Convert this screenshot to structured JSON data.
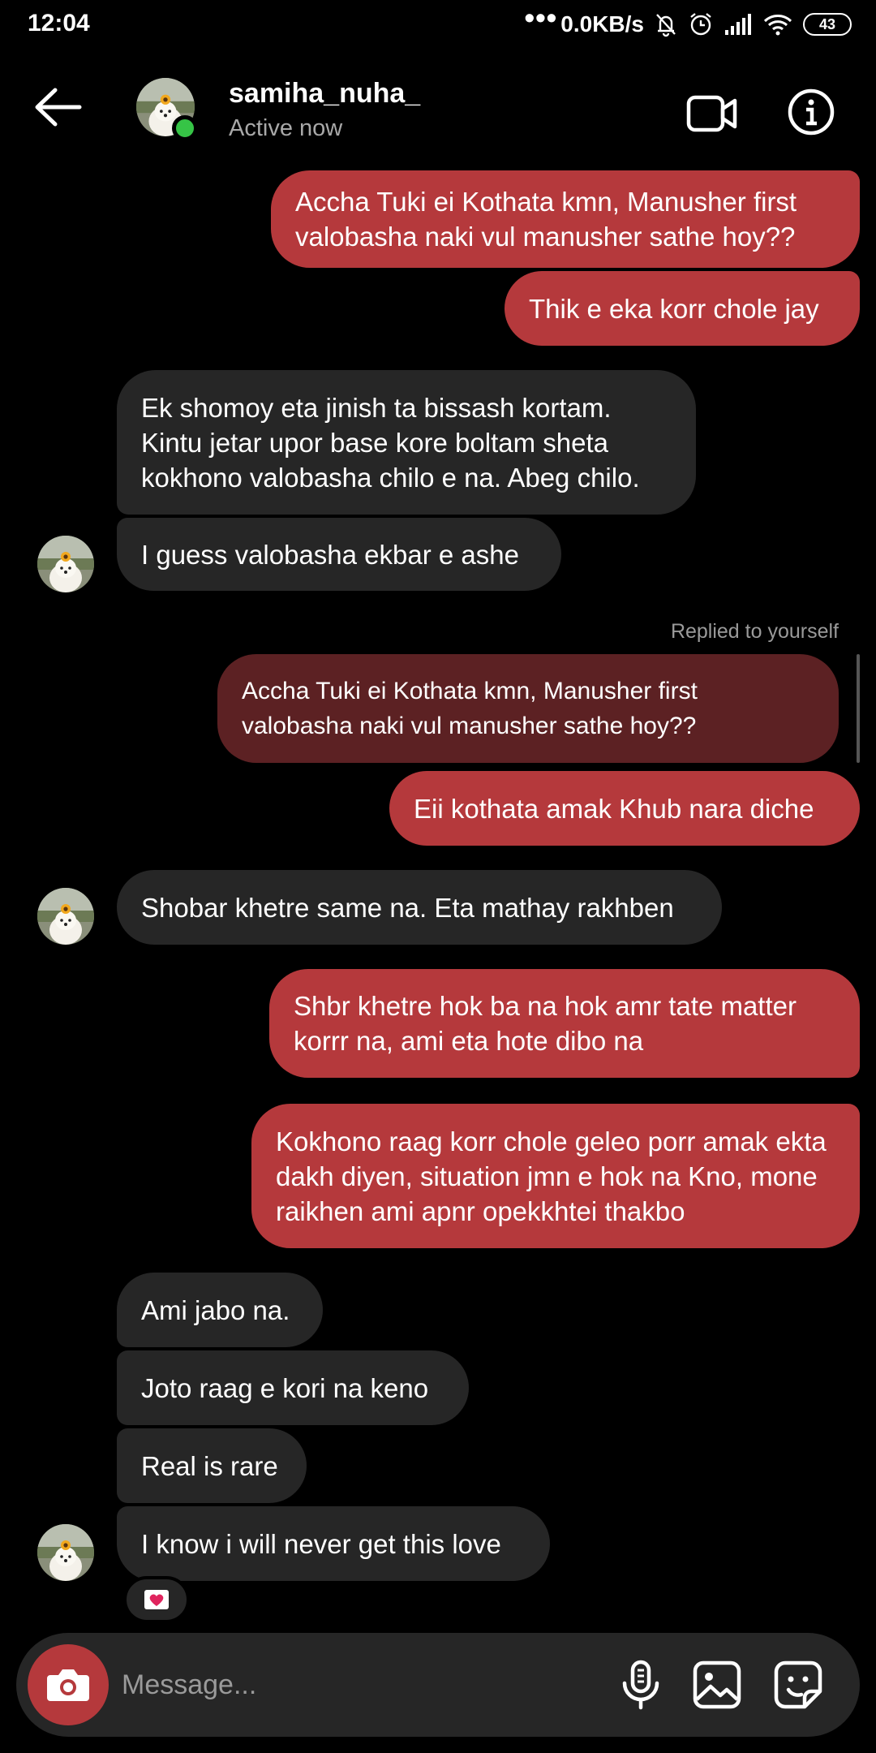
{
  "status_bar": {
    "time": "12:04",
    "dots": "•••",
    "network_speed": "0.0KB/s",
    "battery": "43"
  },
  "header": {
    "username": "samiha_nuha_",
    "status": "Active now",
    "icons": [
      "back-arrow-icon",
      "video-call-icon",
      "info-icon"
    ]
  },
  "messages": [
    {
      "dir": "out",
      "text": "Accha Tuki ei Kothata kmn, Manusher first valobasha naki vul manusher sathe hoy??"
    },
    {
      "dir": "out",
      "text": "Thik e eka korr chole jay"
    },
    {
      "dir": "in",
      "text": "Ek shomoy eta jinish ta bissash kortam. Kintu jetar upor base kore boltam sheta kokhono valobasha chilo e na. Abeg chilo."
    },
    {
      "dir": "in",
      "text": "I guess valobasha ekbar e ashe"
    },
    {
      "dir": "reply_label",
      "text": "Replied to yourself"
    },
    {
      "dir": "quoted",
      "text": "Accha Tuki ei Kothata kmn, Manusher first valobasha naki vul manusher sathe hoy??"
    },
    {
      "dir": "out",
      "text": "Eii kothata amak Khub nara diche"
    },
    {
      "dir": "in",
      "text": "Shobar khetre same na. Eta mathay rakhben"
    },
    {
      "dir": "out",
      "text": "Shbr khetre hok ba na hok amr tate matter korrr na, ami eta hote dibo na"
    },
    {
      "dir": "out",
      "text": "Kokhono raag korr chole geleo porr amak ekta dakh diyen, situation jmn e hok na Kno, mone raikhen ami apnr opekkhtei thakbo"
    },
    {
      "dir": "in",
      "text": "Ami jabo na."
    },
    {
      "dir": "in",
      "text": "Joto raag e kori na keno"
    },
    {
      "dir": "in",
      "text": "Real is rare"
    },
    {
      "dir": "in",
      "text": "I know i will never get this love"
    }
  ],
  "reaction": {
    "icon": "heart-letter-icon",
    "color": "#e0245e"
  },
  "composer": {
    "placeholder": "Message...",
    "icons": [
      "camera-icon",
      "microphone-icon",
      "gallery-icon",
      "sticker-icon"
    ]
  },
  "colors": {
    "outgoing_bubble": "#b5393c",
    "incoming_bubble": "#262626",
    "quoted_bubble": "#5c2123",
    "online": "#36c446",
    "background": "#000000"
  }
}
